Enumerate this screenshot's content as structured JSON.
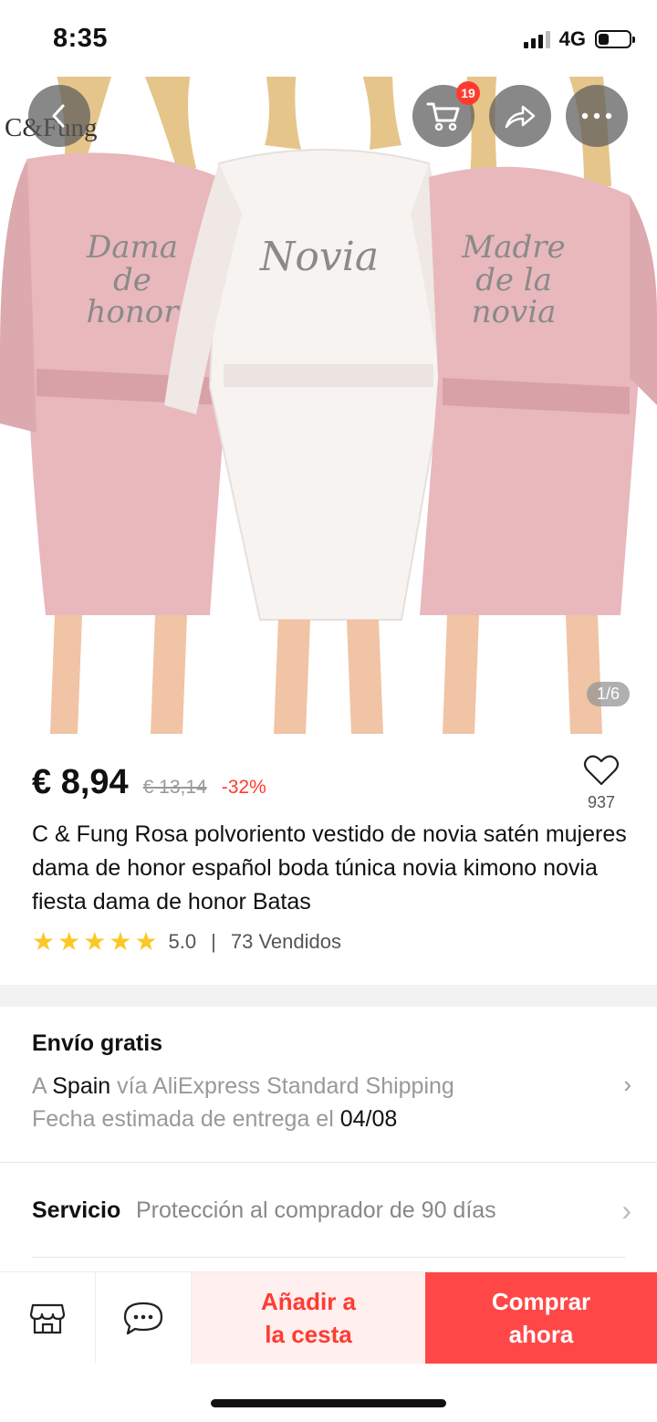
{
  "status_bar": {
    "time": "8:35",
    "network": "4G",
    "battery_level": 0.35
  },
  "product_image": {
    "brand": "C&Fung",
    "robe_texts": [
      "Dama de honor",
      "Novia",
      "Madre de la novia"
    ],
    "counter": "1/6",
    "cart_badge": "19",
    "colors": {
      "pink_robe": "#e8b8bd",
      "white_robe": "#f7f3f1",
      "hair": "#e6c58b",
      "skin": "#f0c4a5"
    }
  },
  "price": {
    "current": "€ 8,94",
    "original": "€ 13,14",
    "discount": "-32%"
  },
  "wishlist": {
    "count": "937"
  },
  "title": "C & Fung Rosa polvoriento vestido de novia satén mujeres dama de honor español boda túnica novia kimono novia fiesta dama de honor Batas",
  "rating": {
    "stars": 5,
    "score": "5.0",
    "sold": "73 Vendidos"
  },
  "shipping": {
    "title": "Envío gratis",
    "prefix": "A",
    "country": "Spain",
    "method": "vía AliExpress Standard Shipping",
    "date_label": "Fecha estimada de entrega el",
    "date": "04/08"
  },
  "service": {
    "label": "Servicio",
    "value": "Protección al comprador de 90 días"
  },
  "actions": {
    "add_to_cart": "Añadir a la cesta",
    "buy_now": "Comprar ahora"
  },
  "theme": {
    "accent": "#ff4747",
    "accent_soft": "#ffefef",
    "star": "#fcc726"
  }
}
